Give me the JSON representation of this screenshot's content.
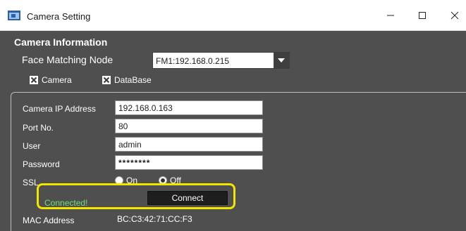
{
  "window": {
    "title": "Camera Setting",
    "icon": "camera-app-icon",
    "controls": [
      "minimize-icon",
      "maximize-icon",
      "close-icon"
    ]
  },
  "camera_info": {
    "section_title": "Camera Information",
    "face_matching_node": {
      "label": "Face Matching Node",
      "selected": "FM1:192.168.0.215"
    },
    "checkboxes": [
      {
        "label": "Camera",
        "checked": true
      },
      {
        "label": "DataBase",
        "checked": true
      }
    ]
  },
  "form": {
    "ip": {
      "label": "Camera IP Address",
      "value": "192.168.0.163"
    },
    "port": {
      "label": "Port No.",
      "value": "80"
    },
    "user": {
      "label": "User",
      "value": "admin"
    },
    "password": {
      "label": "Password",
      "value": "********"
    },
    "ssl": {
      "label": "SSL",
      "options": [
        {
          "label": "On",
          "selected": false
        },
        {
          "label": "Off",
          "selected": true
        }
      ]
    }
  },
  "connection": {
    "status": "Connected!",
    "button_label": "Connect",
    "status_color": "#6fe06f",
    "highlight_color": "#f2e600"
  },
  "mac": {
    "label": "MAC Address",
    "value": "BC:C3:42:71:CC:F3"
  },
  "colors": {
    "client_background": "#4f4f4f",
    "button_background": "#1e1e1e"
  }
}
